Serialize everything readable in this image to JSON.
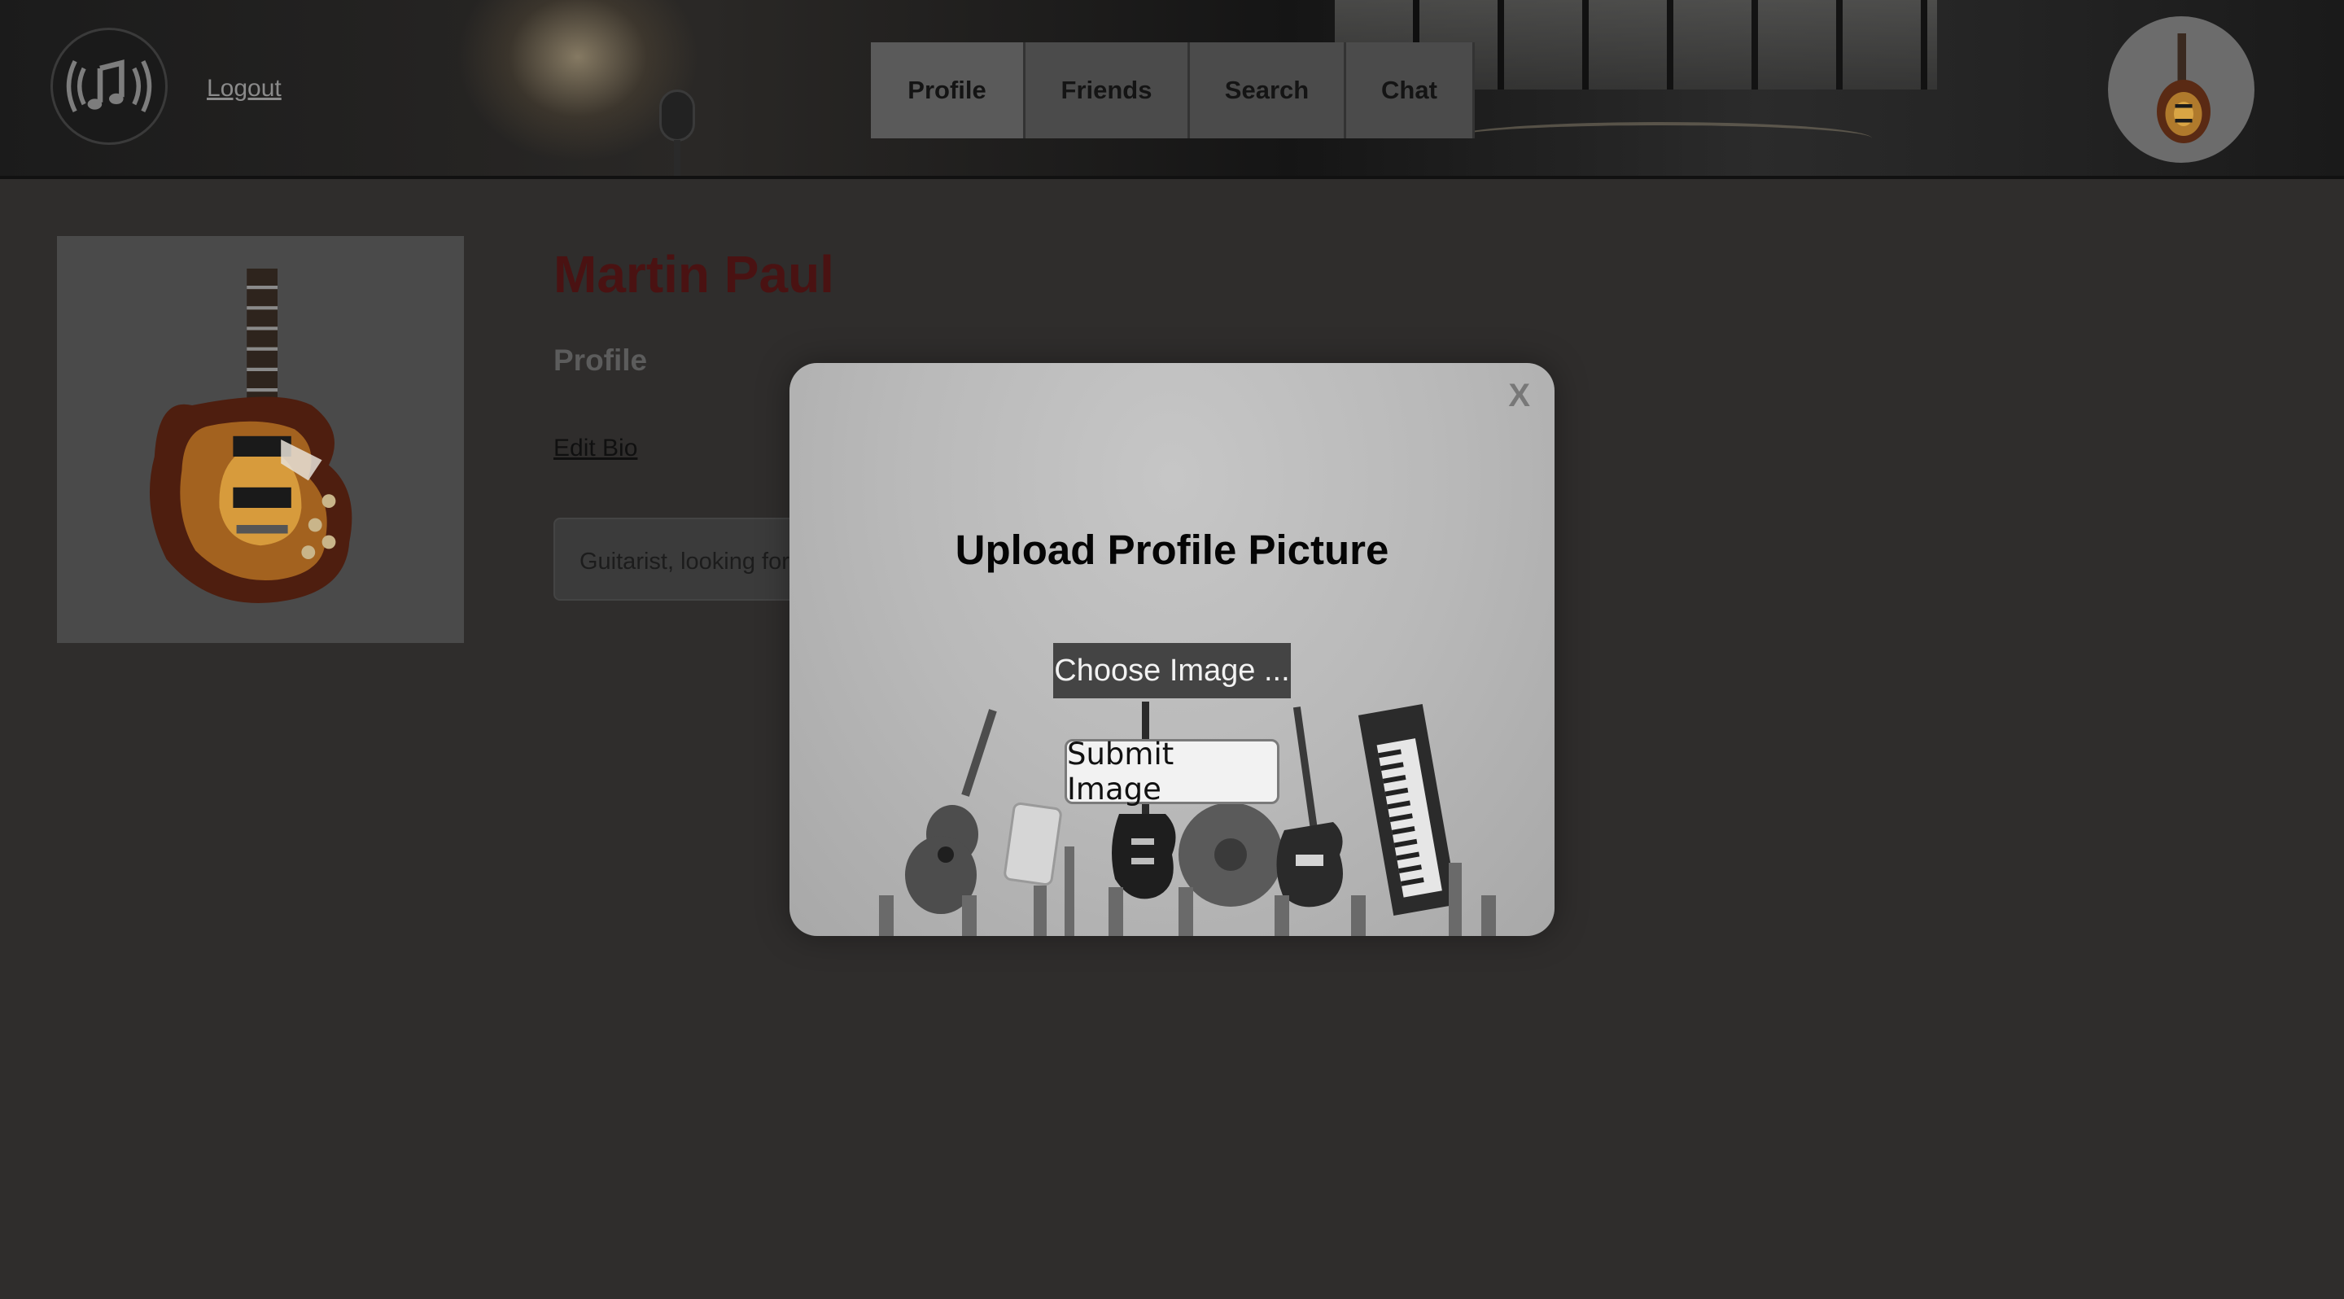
{
  "header": {
    "logo_icon": "music-note-broadcast-icon",
    "logout_label": "Logout",
    "nav_tabs": [
      {
        "label": "Profile",
        "active": true
      },
      {
        "label": "Friends",
        "active": false
      },
      {
        "label": "Search",
        "active": false
      },
      {
        "label": "Chat",
        "active": false
      }
    ],
    "avatar_icon": "guitar-avatar-icon"
  },
  "profile": {
    "name": "Martin Paul",
    "section_title": "Profile",
    "edit_bio_label": "Edit Bio",
    "bio_text": "Guitarist, looking for",
    "photo_icon": "electric-guitar-icon"
  },
  "modal": {
    "close_label": "X",
    "title": "Upload Profile Picture",
    "choose_label": "Choose Image ...",
    "submit_label": "Submit Image"
  },
  "colors": {
    "overlay_dim": "#2f2d2c",
    "name_color": "#4a1212",
    "choose_button": "#444444"
  }
}
